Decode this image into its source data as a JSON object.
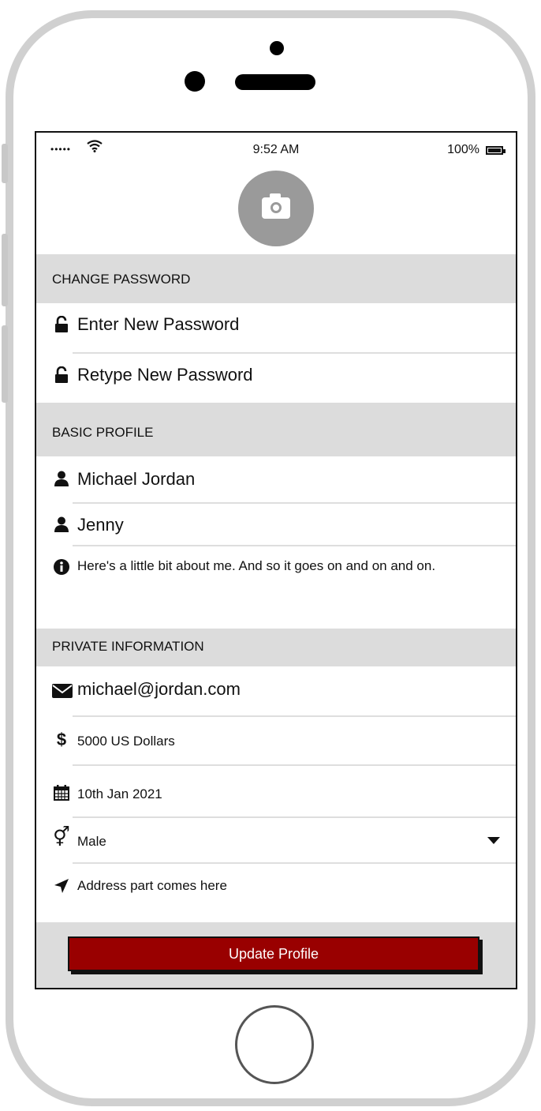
{
  "status_bar": {
    "signal": "•••••",
    "time": "9:52 AM",
    "battery": "100%"
  },
  "sections": {
    "change_password": "CHANGE PASSWORD",
    "basic_profile": "BASIC PROFILE",
    "private_information": "PRIVATE INFORMATION"
  },
  "password": {
    "new_placeholder": "Enter New Password",
    "retype_placeholder": "Retype New Password"
  },
  "profile": {
    "name": "Michael Jordan",
    "nickname": "Jenny",
    "bio": "Here's a little bit about me. And so it goes on and on and on."
  },
  "private": {
    "email": "michael@jordan.com",
    "salary": "5000 US Dollars",
    "date": "10th Jan 2021",
    "gender": "Male",
    "address": "Address part comes here"
  },
  "actions": {
    "update_label": "Update Profile"
  },
  "colors": {
    "accent": "#990000",
    "section_bg": "#dcdcdc",
    "avatar_bg": "#9a9a9a"
  }
}
